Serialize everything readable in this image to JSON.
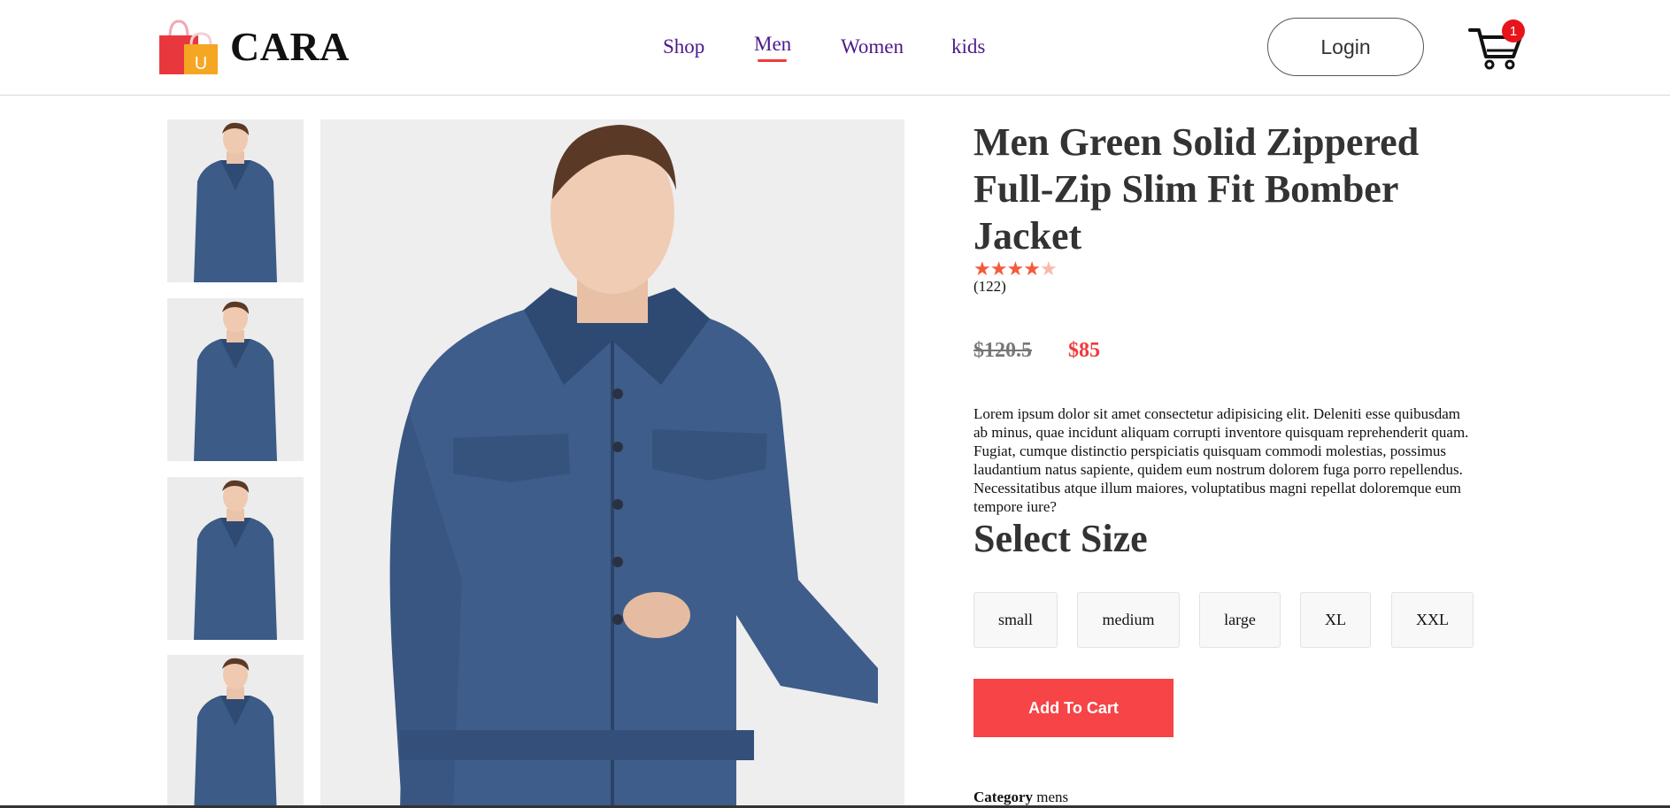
{
  "header": {
    "brand": "CARA",
    "logo_letter": "U",
    "nav": [
      {
        "label": "Shop",
        "active": false
      },
      {
        "label": "Men",
        "active": true
      },
      {
        "label": "Women",
        "active": false
      },
      {
        "label": "kids",
        "active": false
      }
    ],
    "login_label": "Login",
    "cart_count": "1",
    "cart_icon": "shopping-cart-icon"
  },
  "colors": {
    "nav_link": "#4b1a8a",
    "accent_red": "#f64447",
    "star": "#f55a3c",
    "price": "#ef3b3b"
  },
  "product": {
    "title": "Men Green Solid Zippered Full-Zip Slim Fit Bomber Jacket",
    "rating": 4.5,
    "rating_max": 5,
    "reviews": "(122)",
    "old_price": "$120.5",
    "price": "$85",
    "description": "Lorem ipsum dolor sit amet consectetur adipisicing elit. Deleniti esse quibusdam ab minus, quae incidunt aliquam corrupti inventore quisquam reprehenderit quam. Fugiat, cumque distinctio perspiciatis quisquam commodi molestias, possimus laudantium natus sapiente, quidem eum nostrum dolorem fuga porro repellendus. Necessitatibus atque illum maiores, voluptatibus magni repellat doloremque eum tempore iure?",
    "select_size_title": "Select Size",
    "sizes": [
      "small",
      "medium",
      "large",
      "XL",
      "XXL"
    ],
    "add_to_cart_label": "Add To Cart",
    "category_label": "Category",
    "category_value": "mens"
  },
  "gallery": {
    "thumbnail_count": 4,
    "image_subject": "man wearing blue denim jacket"
  }
}
